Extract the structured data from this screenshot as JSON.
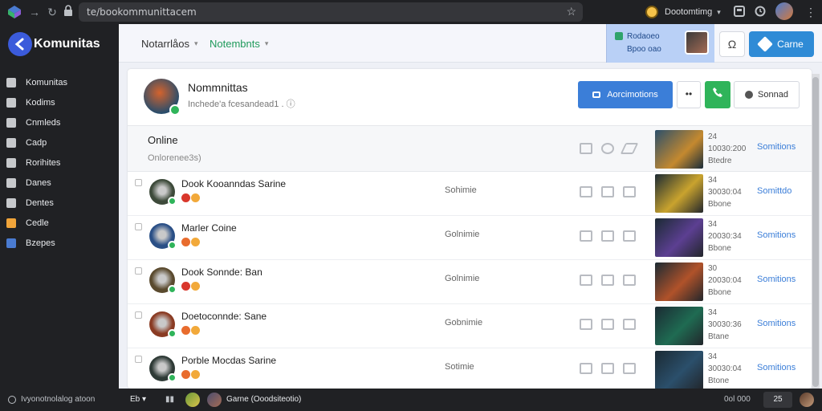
{
  "browser": {
    "url": "te/bookommunittacem",
    "account_name": "Dootomtimg"
  },
  "sidebar": {
    "brand": "Komunitas",
    "items": [
      {
        "label": "Komunitas",
        "icon": "grid-icon",
        "color": "#c7c9cc"
      },
      {
        "label": "Kodims",
        "icon": "box-icon",
        "color": "#c7c9cc"
      },
      {
        "label": "Cnmleds",
        "icon": "chat-icon",
        "color": "#c7c9cc"
      },
      {
        "label": "Cadp",
        "icon": "flag-icon",
        "color": "#c7c9cc"
      },
      {
        "label": "Rorihites",
        "icon": "pen-icon",
        "color": "#c7c9cc"
      },
      {
        "label": "Danes",
        "icon": "calendar-icon",
        "color": "#c7c9cc"
      },
      {
        "label": "Dentes",
        "icon": "users-icon",
        "color": "#c7c9cc"
      },
      {
        "label": "Cedle",
        "icon": "key-icon",
        "color": "#f0a43a"
      },
      {
        "label": "Bzepes",
        "icon": "puzzle-icon",
        "color": "#4a7bd1"
      }
    ]
  },
  "topnav": {
    "tab1": "Notarrlåos",
    "tab2": "Notembnts",
    "promo_line1": "Rodaoeo",
    "promo_line2": "Bpoo oao",
    "search_glyph": "Ω",
    "cta_label": "Carne"
  },
  "header": {
    "title": "Nommnittas",
    "subtitle": "Inchede'a fcesandead1 . ⓘ",
    "primary_button": "Aorcimotions",
    "more_button": "••",
    "secondary_button": "Sonnad"
  },
  "online": {
    "title": "Online",
    "subtitle": "Onlorenee3s)",
    "meta_line1": "24",
    "meta_line2": "10030:200",
    "meta_line3": "Btedre",
    "link": "Somitions"
  },
  "rows": [
    {
      "name": "Dook Kooanndas Sarine",
      "status": "Sohimie",
      "meta1": "34",
      "meta2": "30030:04",
      "meta3": "Bbone",
      "link": "Somittdo",
      "avatar_color": "#3d4a3a",
      "thumb_color": "#c9a32e"
    },
    {
      "name": "Marler Coine",
      "status": "Golnimie",
      "meta1": "34",
      "meta2": "20030:34",
      "meta3": "Bbone",
      "link": "Somitions",
      "avatar_color": "#2a4f86",
      "thumb_color": "#5c3f92"
    },
    {
      "name": "Dook Sonnde: Ban",
      "status": "Golnimie",
      "meta1": "30",
      "meta2": "20030:04",
      "meta3": "Bbone",
      "link": "Somitions",
      "avatar_color": "#5a4a2e",
      "thumb_color": "#b0522a"
    },
    {
      "name": "Doetoconnde: Sane",
      "status": "Gobnimie",
      "meta1": "34",
      "meta2": "30030:36",
      "meta3": "Btane",
      "link": "Somitions",
      "avatar_color": "#8a3b23",
      "thumb_color": "#1f6b52"
    },
    {
      "name": "Porble Mocdas Sarine",
      "status": "Sotimie",
      "meta1": "34",
      "meta2": "30030:04",
      "meta3": "Btone",
      "link": "Somitions",
      "avatar_color": "#2e3a36",
      "thumb_color": "#2b4f6b"
    }
  ],
  "statusbar": {
    "left_text": "Ivyonotnolalog atoon",
    "filter_label": "Eb ▾",
    "user_text": "Garne (Ooodsiteotio)",
    "right_text": "0ol 000",
    "count": "25"
  }
}
